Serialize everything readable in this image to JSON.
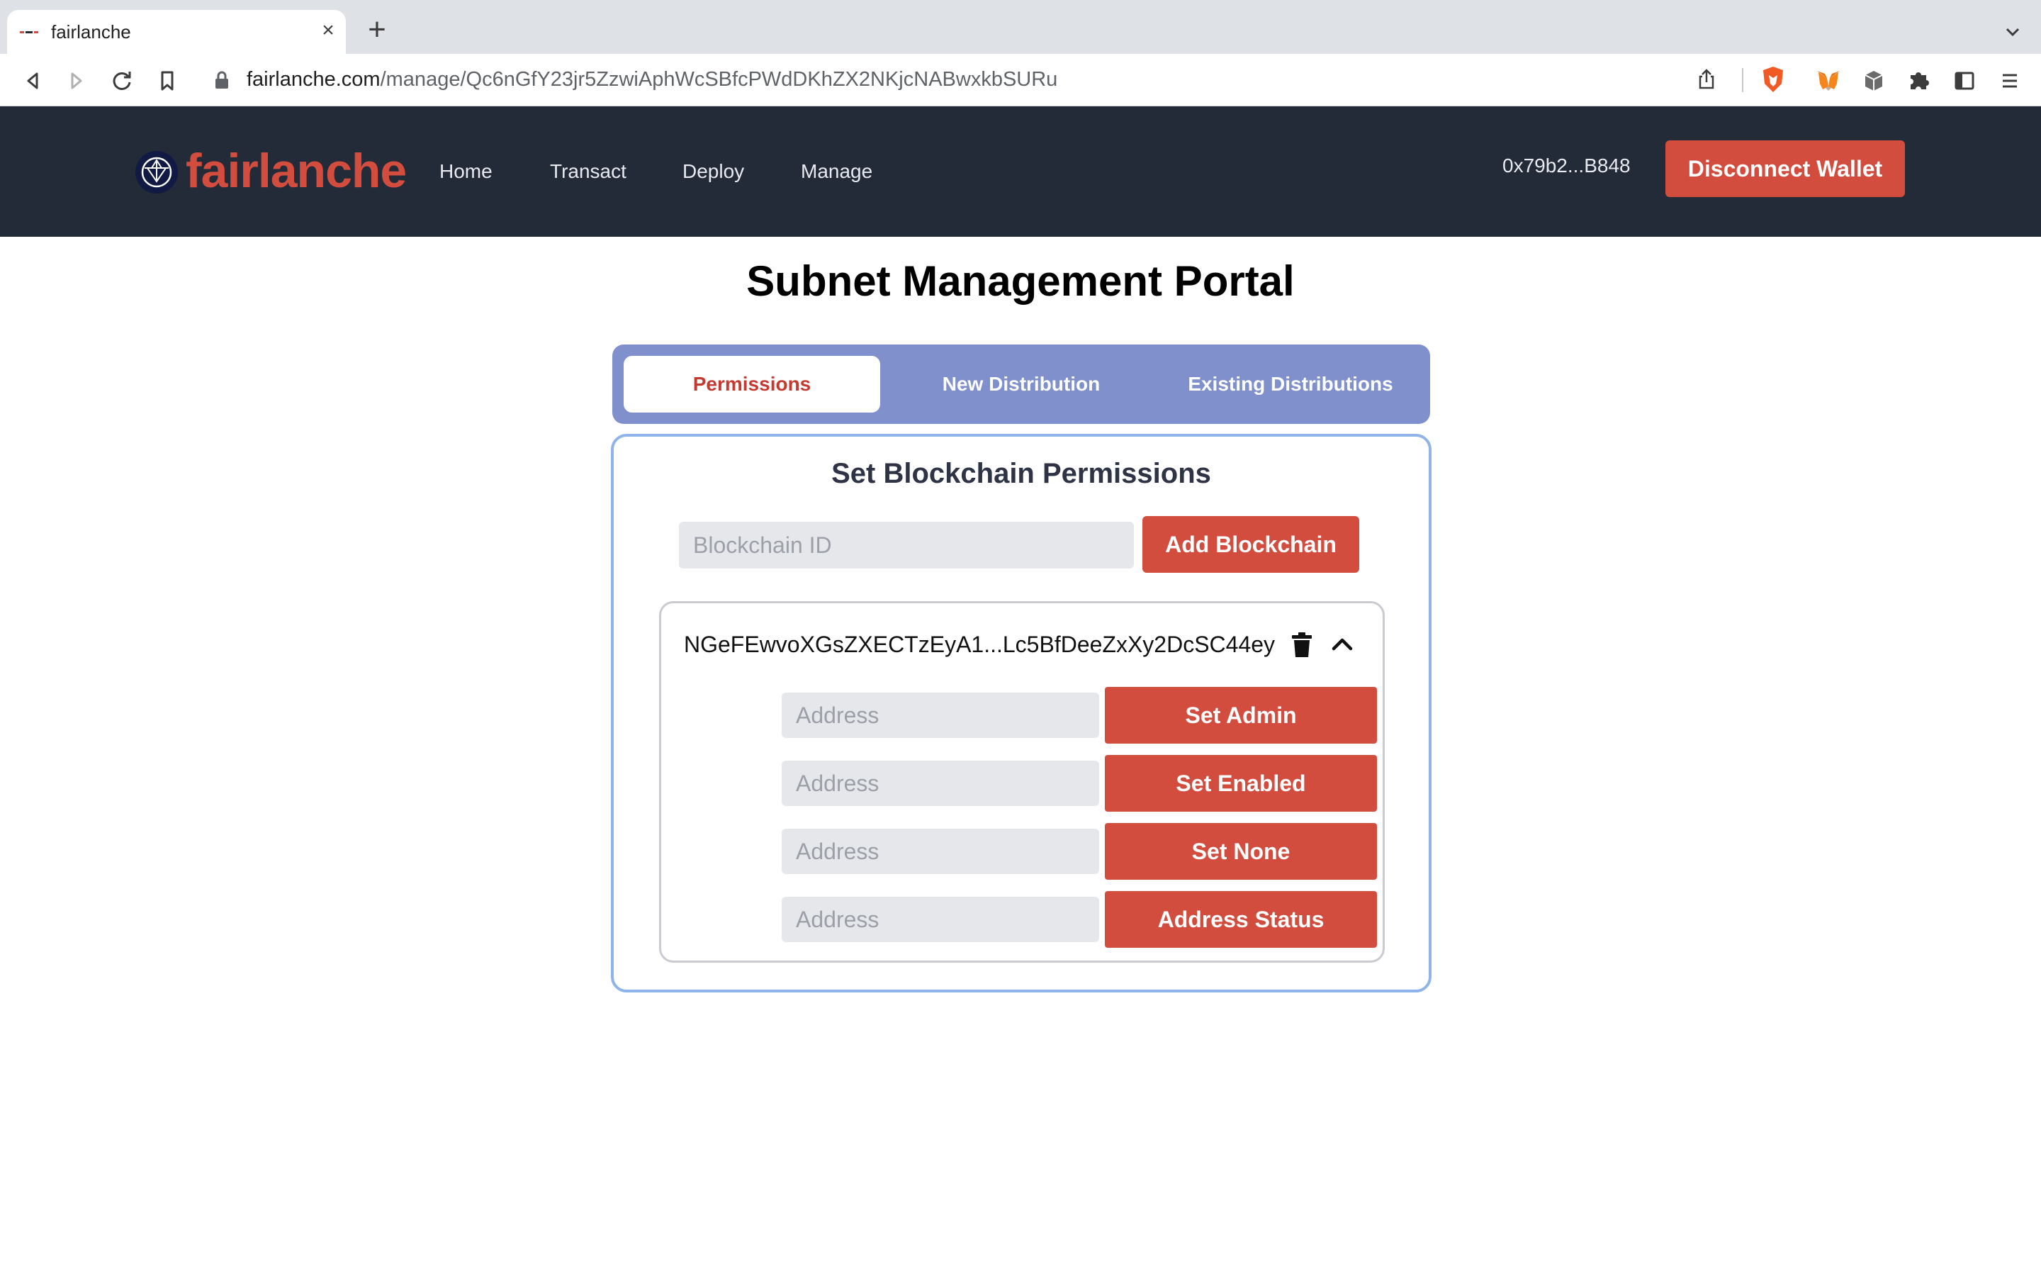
{
  "browser": {
    "tab_title": "fairlanche",
    "url_host": "fairlanche.com",
    "url_path": "/manage/Qc6nGfY23jr5ZzwiAphWcSBfcPWdDKhZX2NKjcNABwxkbSURu",
    "icons": [
      "back-icon",
      "forward-icon",
      "reload-icon",
      "bookmark-icon",
      "lock-icon",
      "share-icon",
      "brave-shield-icon",
      "metamask-icon",
      "cube-extension-icon",
      "puzzle-extensions-icon",
      "sidebar-icon",
      "menu-icon"
    ]
  },
  "header": {
    "logo_text": "fairlanche",
    "nav": [
      "Home",
      "Transact",
      "Deploy",
      "Manage"
    ],
    "wallet_address": "0x79b2...B848",
    "disconnect_label": "Disconnect Wallet",
    "brand_color": "#d24d3e",
    "bg_color": "#232a38"
  },
  "main": {
    "title": "Subnet Management Portal",
    "tabs": [
      {
        "label": "Permissions",
        "active": true
      },
      {
        "label": "New Distribution",
        "active": false
      },
      {
        "label": "Existing Distributions",
        "active": false
      }
    ],
    "panel_title": "Set Blockchain Permissions",
    "blockchain_placeholder": "Blockchain ID",
    "add_blockchain_label": "Add Blockchain",
    "chain": {
      "id": "NGeFEwvoXGsZXECTzEyA1...Lc5BfDeeZxXy2DcSC44ey",
      "rows": [
        {
          "placeholder": "Address",
          "action": "Set Admin"
        },
        {
          "placeholder": "Address",
          "action": "Set Enabled"
        },
        {
          "placeholder": "Address",
          "action": "Set None"
        },
        {
          "placeholder": "Address",
          "action": "Address Status"
        }
      ]
    }
  }
}
